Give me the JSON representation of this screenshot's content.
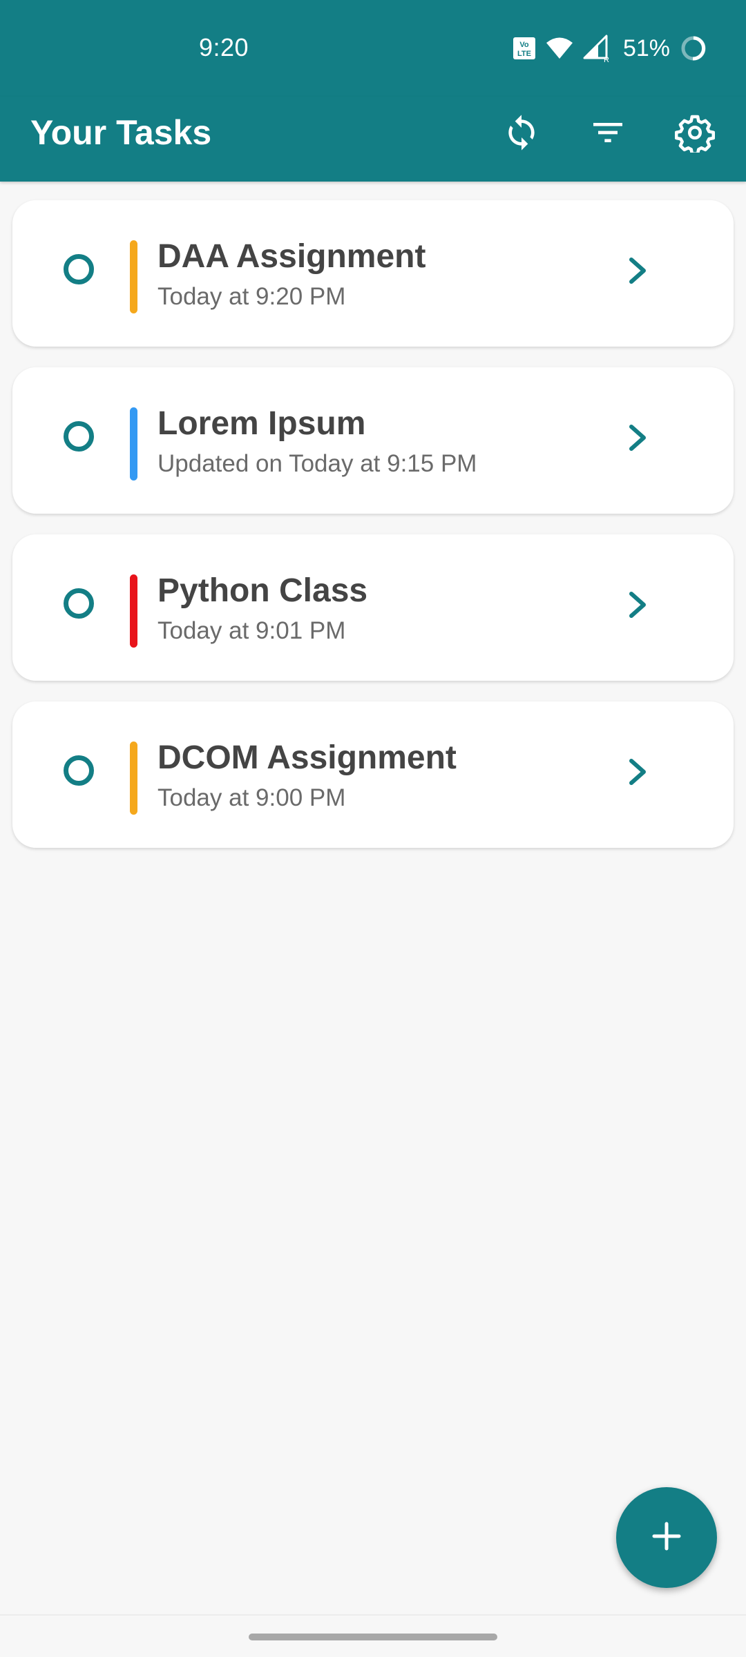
{
  "status_bar": {
    "time": "9:20",
    "volte_icon": "volte-lte-icon",
    "wifi_icon": "wifi-icon",
    "signal_icon": "cell-signal-icon",
    "battery": "51%",
    "battery_icon": "battery-ring-icon"
  },
  "app_bar": {
    "title": "Your Tasks",
    "actions": [
      {
        "name": "sync-icon"
      },
      {
        "name": "filter-icon"
      },
      {
        "name": "settings-gear-icon"
      }
    ],
    "background_color": "#137e85"
  },
  "tasks": [
    {
      "title": "DAA Assignment",
      "subtitle": "Today at 9:20 PM",
      "priority_color": "#f5a81c"
    },
    {
      "title": "Lorem Ipsum",
      "subtitle": "Updated on Today at 9:15 PM",
      "priority_color": "#3399f3"
    },
    {
      "title": "Python Class",
      "subtitle": "Today at 9:01 PM",
      "priority_color": "#e8141b"
    },
    {
      "title": "DCOM Assignment",
      "subtitle": "Today at 9:00 PM",
      "priority_color": "#f5a81c"
    }
  ],
  "fab": {
    "icon": "plus-icon"
  },
  "colors": {
    "accent": "#137e85",
    "background": "#f7f7f7",
    "card": "#ffffff"
  }
}
